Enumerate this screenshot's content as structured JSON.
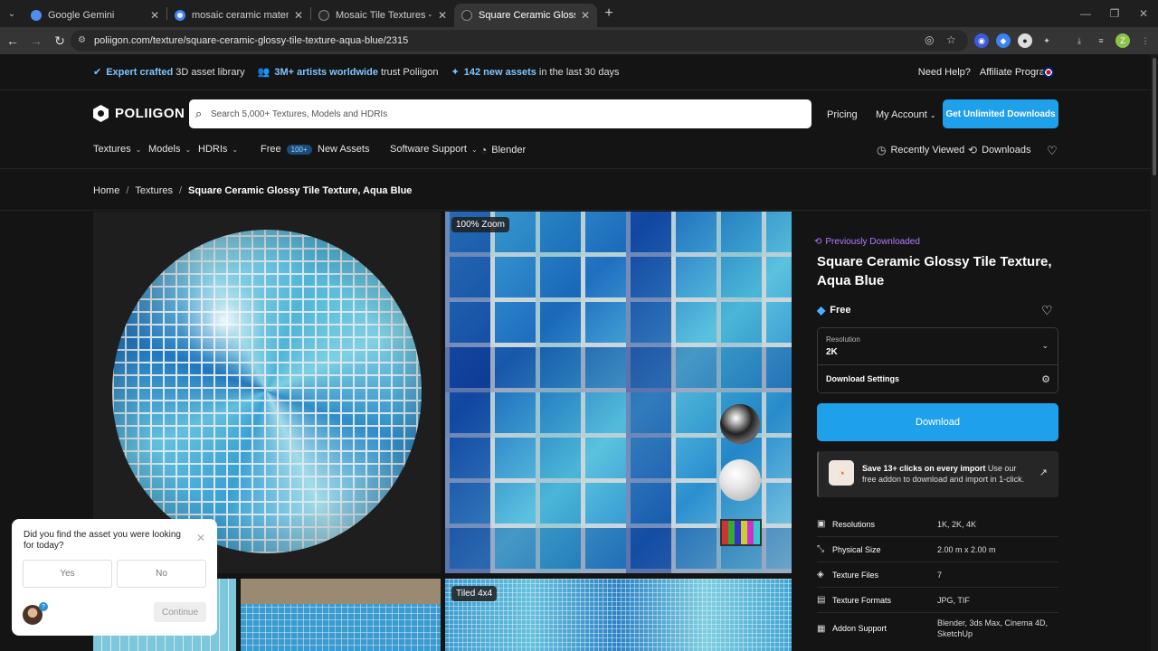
{
  "browser": {
    "tabs": [
      {
        "title": "Google Gemini",
        "color": "#4f8df5"
      },
      {
        "title": "mosaic ceramic material for un",
        "color": "#e8e8e8"
      },
      {
        "title": "Mosaic Tile Textures - Poliigon",
        "color": "#2a2a2a"
      },
      {
        "title": "Square Ceramic Glossy Tile Text",
        "color": "#2a2a2a"
      }
    ],
    "url": "poliigon.com/texture/square-ceramic-glossy-tile-texture-aqua-blue/2315"
  },
  "promo": {
    "item1_hl": "Expert crafted",
    "item1_rest": "3D asset library",
    "item2_hl": "3M+ artists worldwide",
    "item2_rest": "trust Poliigon",
    "item3_hl": "142 new assets",
    "item3_rest": "in the last 30 days",
    "need_help": "Need Help?",
    "affiliate": "Affiliate Program"
  },
  "header": {
    "logo": "POLIIGON",
    "search_placeholder": "Search 5,000+ Textures, Models and HDRIs",
    "pricing": "Pricing",
    "my_account": "My Account",
    "cta": "Get Unlimited Downloads"
  },
  "menu": {
    "textures": "Textures",
    "models": "Models",
    "hdris": "HDRIs",
    "free": "Free",
    "free_badge": "100+",
    "new_assets": "New Assets",
    "software_support": "Software Support",
    "blender": "Blender",
    "recently_viewed": "Recently Viewed",
    "downloads": "Downloads"
  },
  "breadcrumb": {
    "home": "Home",
    "textures": "Textures",
    "current": "Square Ceramic Glossy Tile Texture, Aqua Blue"
  },
  "gallery": {
    "zoom_label": "100% Zoom",
    "tiled_label": "Tiled 4x4"
  },
  "asset": {
    "previously_downloaded": "Previously Downloaded",
    "title": "Square Ceramic Glossy Tile Texture, Aqua Blue",
    "price": "Free",
    "resolution_label": "Resolution",
    "resolution_value": "2K",
    "download_settings": "Download Settings",
    "download_button": "Download",
    "addon_bold": "Save 13+ clicks on every import",
    "addon_text": " Use our free addon to download and import in 1-click."
  },
  "specs": [
    {
      "icon": "resolution-icon",
      "key": "Resolutions",
      "value": "1K, 2K, 4K"
    },
    {
      "icon": "size-icon",
      "key": "Physical Size",
      "value": "2.00 m x 2.00 m"
    },
    {
      "icon": "layers-icon",
      "key": "Texture Files",
      "value": "7"
    },
    {
      "icon": "file-icon",
      "key": "Texture Formats",
      "value": "JPG, TIF"
    },
    {
      "icon": "addon-icon",
      "key": "Addon Support",
      "value": "Blender, 3ds Max, Cinema 4D, SketchUp"
    }
  ],
  "survey": {
    "question": "Did you find the asset you were looking for today?",
    "yes": "Yes",
    "no": "No",
    "continue": "Continue",
    "badge": "?"
  },
  "colors": {
    "accent": "#1fa0ea",
    "purple": "#b27cff",
    "background": "#141414"
  }
}
